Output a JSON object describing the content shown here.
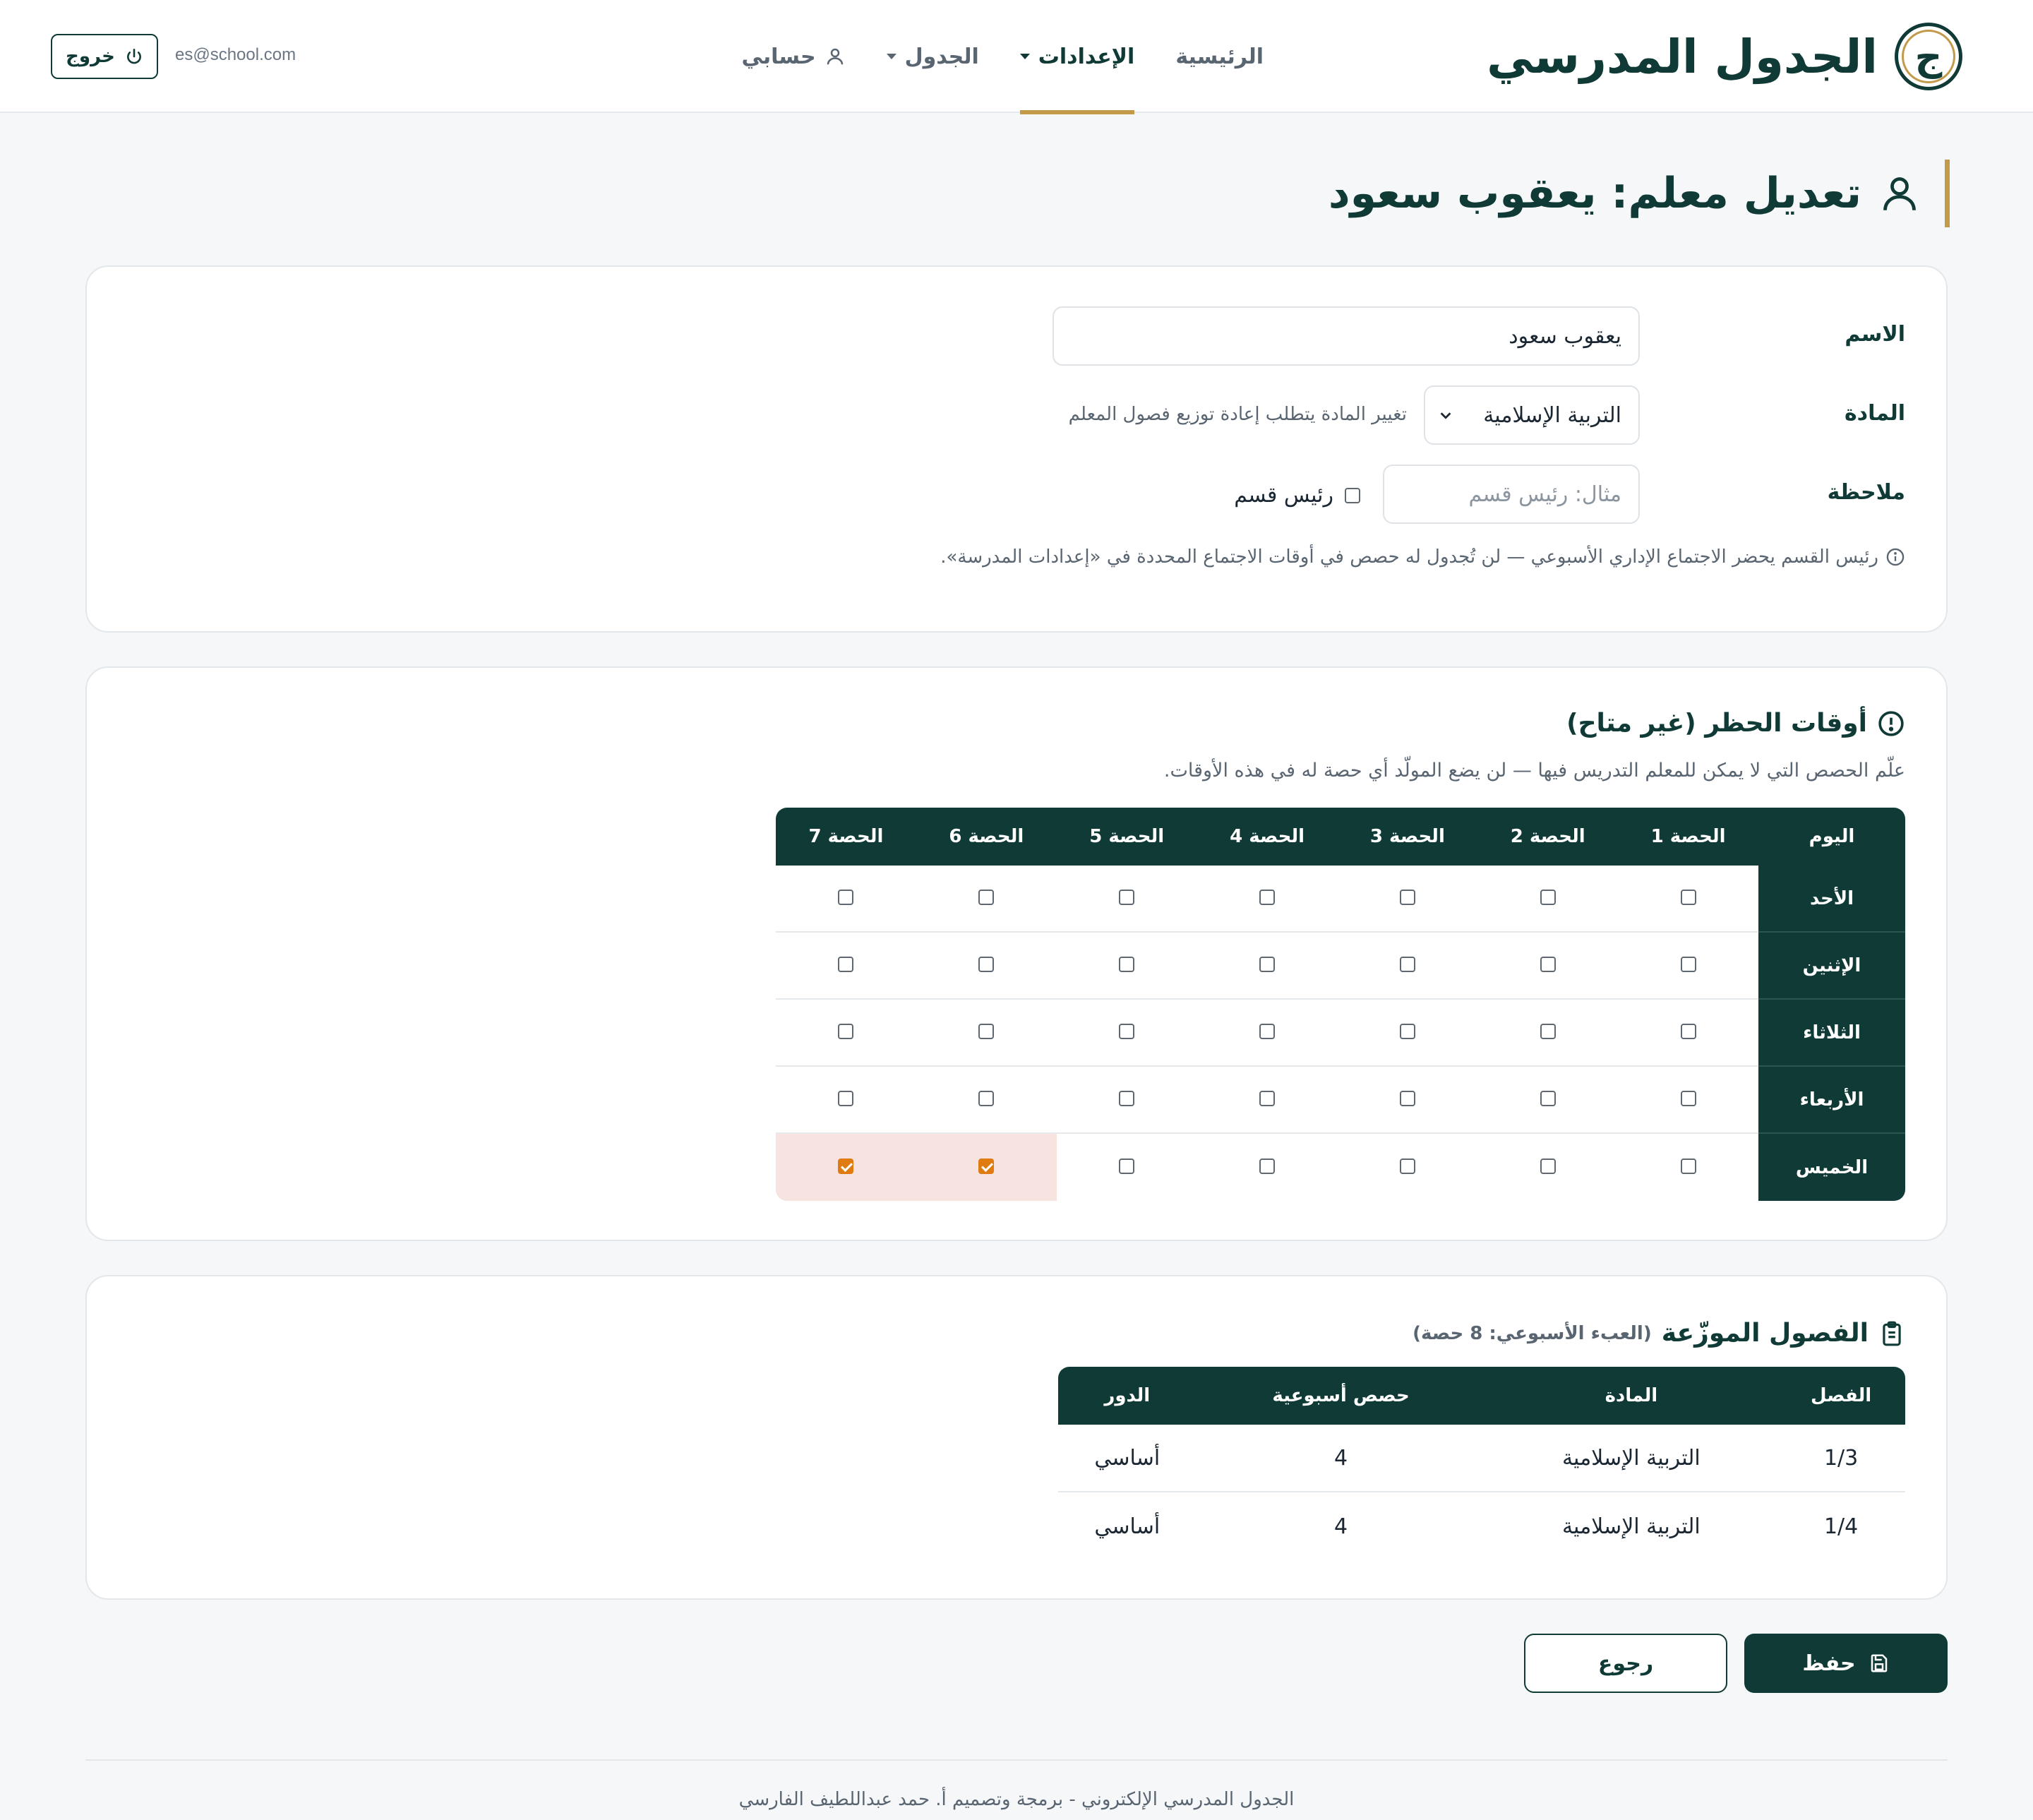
{
  "brand": {
    "title": "الجدول المدرسي",
    "logo_letter": "ج"
  },
  "nav": {
    "home": "الرئيسية",
    "settings": "الإعدادات",
    "schedule": "الجدول",
    "account": "حسابي",
    "active": "settings"
  },
  "user": {
    "email": "es@school.com",
    "logout_label": "خروج"
  },
  "page": {
    "title": "تعديل معلم: يعقوب سعود"
  },
  "form": {
    "name_label": "الاسم",
    "name_value": "يعقوب سعود",
    "subject_label": "المادة",
    "subject_value": "التربية الإسلامية",
    "subject_hint": "تغيير المادة يتطلب إعادة توزيع فصول المعلم",
    "note_label": "ملاحظة",
    "note_placeholder": "مثال: رئيس قسم",
    "head_checkbox_label": "رئيس قسم",
    "head_checked": false,
    "info_text": "رئيس القسم يحضر الاجتماع الإداري الأسبوعي — لن تُجدول له حصص في أوقات الاجتماع المحددة في «إعدادات المدرسة»."
  },
  "availability": {
    "title": "أوقات الحظر (غير متاح)",
    "description": "علّم الحصص التي لا يمكن للمعلم التدريس فيها — لن يضع المولّد أي حصة له في هذه الأوقات.",
    "day_header": "اليوم",
    "periods": [
      "الحصة 1",
      "الحصة 2",
      "الحصة 3",
      "الحصة 4",
      "الحصة 5",
      "الحصة 6",
      "الحصة 7"
    ],
    "days": [
      {
        "name": "الأحد",
        "blocked": [
          false,
          false,
          false,
          false,
          false,
          false,
          false
        ]
      },
      {
        "name": "الإثنين",
        "blocked": [
          false,
          false,
          false,
          false,
          false,
          false,
          false
        ]
      },
      {
        "name": "الثلاثاء",
        "blocked": [
          false,
          false,
          false,
          false,
          false,
          false,
          false
        ]
      },
      {
        "name": "الأربعاء",
        "blocked": [
          false,
          false,
          false,
          false,
          false,
          false,
          false
        ]
      },
      {
        "name": "الخميس",
        "blocked": [
          false,
          false,
          false,
          false,
          false,
          true,
          true
        ]
      }
    ]
  },
  "classes": {
    "title": "الفصول الموزّعة",
    "subtitle": "(العبء الأسبوعي: 8 حصة)",
    "headers": [
      "الفصل",
      "المادة",
      "حصص أسبوعية",
      "الدور"
    ],
    "rows": [
      [
        "1/3",
        "التربية الإسلامية",
        "4",
        "أساسي"
      ],
      [
        "1/4",
        "التربية الإسلامية",
        "4",
        "أساسي"
      ]
    ]
  },
  "actions": {
    "save_label": "حفظ",
    "back_label": "رجوع"
  },
  "footer": {
    "text": "الجدول المدرسي الإلكتروني - برمجة وتصميم أ. حمد عبداللطيف الفارسي"
  },
  "colors": {
    "primary": "#0f3a36",
    "accent_gold": "#c39a4a",
    "blocked_bg": "#f7e3df",
    "checkbox_checked": "#e07b12"
  }
}
